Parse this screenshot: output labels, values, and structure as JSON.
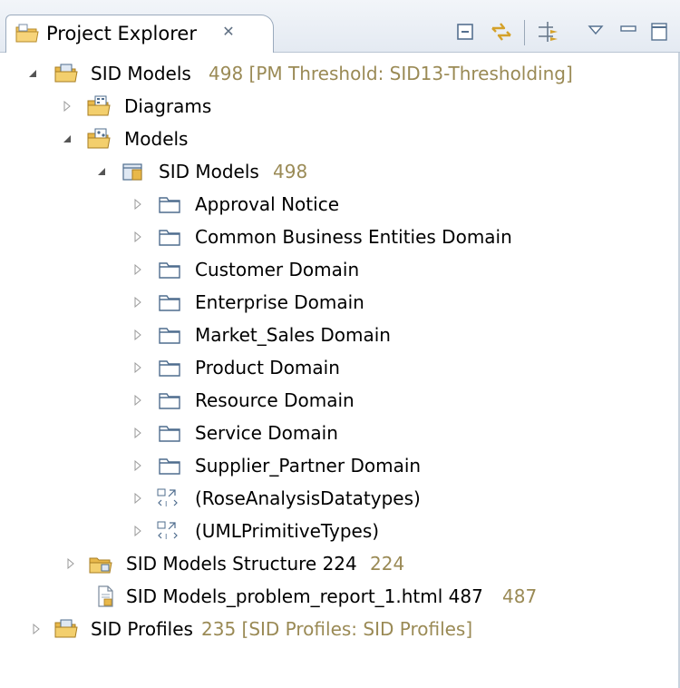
{
  "view": {
    "title": "Project Explorer",
    "close_glyph": "✕"
  },
  "toolbar": {
    "buttons": [
      "collapse-all-icon",
      "link-with-editor-icon",
      "filter-icon",
      "view-menu-icon",
      "minimize-icon",
      "maximize-icon"
    ]
  },
  "tree": [
    {
      "label": "SID Models",
      "decoration": "498 [PM Threshold: SID13-Thresholding]",
      "icon": "model-project-icon",
      "expanded": true
    },
    {
      "label": "Diagrams",
      "decoration": "",
      "icon": "diagrams-folder-icon",
      "expanded": false
    },
    {
      "label": "Models",
      "decoration": "",
      "icon": "models-folder-icon",
      "expanded": true
    },
    {
      "label": "SID Models",
      "decoration": "498",
      "icon": "model-icon",
      "expanded": true
    },
    {
      "label": "Approval Notice",
      "decoration": "",
      "icon": "package-icon",
      "expanded": false
    },
    {
      "label": "Common Business Entities Domain",
      "decoration": "",
      "icon": "package-icon",
      "expanded": false
    },
    {
      "label": "Customer Domain",
      "decoration": "",
      "icon": "package-icon",
      "expanded": false
    },
    {
      "label": "Enterprise Domain",
      "decoration": "",
      "icon": "package-icon",
      "expanded": false
    },
    {
      "label": "Market_Sales Domain",
      "decoration": "",
      "icon": "package-icon",
      "expanded": false
    },
    {
      "label": "Product Domain",
      "decoration": "",
      "icon": "package-icon",
      "expanded": false
    },
    {
      "label": "Resource Domain",
      "decoration": "",
      "icon": "package-icon",
      "expanded": false
    },
    {
      "label": "Service Domain",
      "decoration": "",
      "icon": "package-icon",
      "expanded": false
    },
    {
      "label": "Supplier_Partner Domain",
      "decoration": "",
      "icon": "package-icon",
      "expanded": false
    },
    {
      "label": "(RoseAnalysisDatatypes)",
      "decoration": "",
      "icon": "model-library-icon",
      "expanded": false
    },
    {
      "label": "(UMLPrimitiveTypes)",
      "decoration": "",
      "icon": "model-library-icon",
      "expanded": false
    },
    {
      "label": "SID Models Structure 224",
      "decoration": "224",
      "icon": "structure-folder-icon",
      "expanded": false
    },
    {
      "label": "SID Models_problem_report_1.html 487",
      "decoration": "487",
      "icon": "html-file-icon",
      "expanded": null
    },
    {
      "label": "SID Profiles",
      "decoration": "235 [SID Profiles: SID Profiles]",
      "icon": "profile-project-icon",
      "expanded": false
    }
  ],
  "colors": {
    "decoration": "#9a8a55",
    "folder": "#e8b84a",
    "package_stroke": "#4f6d8e",
    "twisty": "#8a8a8a"
  }
}
